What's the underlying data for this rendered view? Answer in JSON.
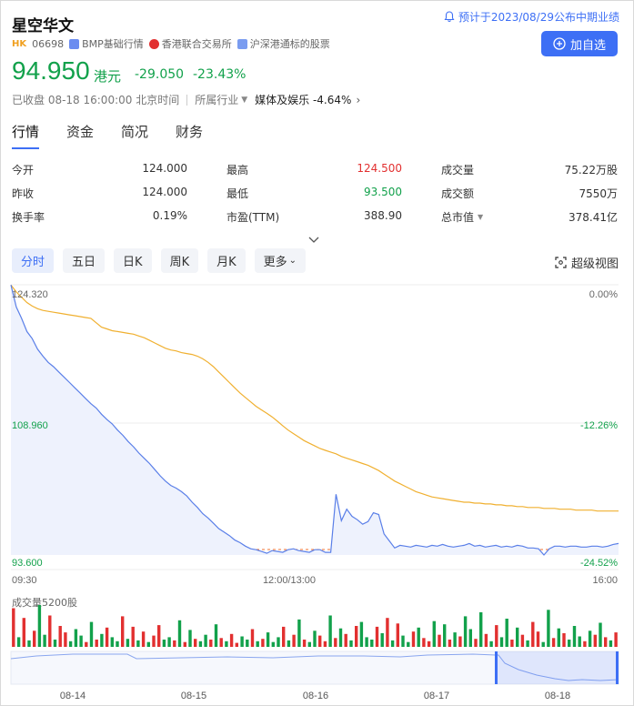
{
  "stock": {
    "name": "星空华文",
    "market": "HK",
    "code": "06698",
    "tag1": "BMP基础行情",
    "tag2": "香港联合交易所",
    "tag3": "沪深港通标的股票",
    "notice": "预计于2023/08/29公布中期业绩",
    "add_button": "加自选",
    "price": "94.950",
    "currency": "港元",
    "change": "-29.050",
    "change_pct": "-23.43%",
    "status_time": "已收盘 08-18 16:00:00 北京时间",
    "industry_label": "所属行业",
    "industry_value": "媒体及娱乐 -4.64%"
  },
  "tabs": [
    "行情",
    "资金",
    "简况",
    "财务"
  ],
  "stats": {
    "open_label": "今开",
    "open": "124.000",
    "high_label": "最高",
    "high": "124.500",
    "volume_label": "成交量",
    "volume": "75.22万股",
    "prev_label": "昨收",
    "prev": "124.000",
    "low_label": "最低",
    "low": "93.500",
    "amount_label": "成交额",
    "amount": "7550万",
    "turnover_label": "换手率",
    "turnover": "0.19%",
    "pe_label": "市盈(TTM)",
    "pe": "388.90",
    "mcap_label": "总市值",
    "mcap": "378.41亿"
  },
  "periods": [
    "分时",
    "五日",
    "日K",
    "周K",
    "月K",
    "更多"
  ],
  "super_view": "超级视图",
  "colors": {
    "accent": "#3d6ff5",
    "down": "#12a14b",
    "up": "#e23030",
    "avg_line": "#f0b030",
    "price_line": "#5a7fe8"
  },
  "chart_data": {
    "type": "line",
    "y_top_label": "124.320",
    "y_mid_label": "108.960",
    "y_bottom_label": "93.600",
    "pct_top": "0.00%",
    "pct_mid": "-12.26%",
    "pct_bottom": "-24.52%",
    "x_labels": [
      "09:30",
      "12:00/13:00",
      "16:00"
    ],
    "ylim": [
      93.6,
      124.32
    ],
    "prev_close": 124.0,
    "series": [
      {
        "values": [
          124.3,
          121.8,
          120.5,
          119.0,
          118.2,
          117.0,
          116.2,
          115.5,
          115.0,
          114.4,
          113.8,
          113.2,
          112.6,
          112.0,
          111.4,
          110.8,
          110.3,
          109.6,
          109.0,
          108.5,
          107.8,
          107.2,
          106.5,
          105.9,
          105.2,
          104.6,
          104.0,
          103.3,
          102.6,
          102.0,
          101.5,
          101.2,
          100.8,
          100.3,
          99.6,
          99.0,
          98.3,
          97.8,
          97.2,
          96.6,
          96.2,
          95.8,
          95.3,
          95.0,
          94.6,
          94.3,
          94.2,
          94.0,
          93.8,
          94.1,
          94.0,
          93.9,
          94.2,
          94.3,
          94.1,
          94.0,
          93.9,
          94.2,
          94.2,
          93.9,
          93.9,
          100.5,
          97.5,
          98.8,
          98.0,
          97.6,
          97.1,
          97.4,
          98.4,
          98.2,
          96.0,
          95.2,
          94.4,
          94.7,
          94.6,
          94.5,
          94.7,
          94.6,
          94.5,
          94.7,
          94.6,
          94.8,
          94.6,
          94.5,
          94.6,
          94.7,
          94.9,
          94.6,
          94.7,
          94.5,
          94.6,
          94.7,
          94.5,
          94.6,
          94.5,
          94.7,
          94.6,
          94.4,
          94.4,
          94.3,
          93.6,
          94.3,
          94.6,
          94.6,
          94.5,
          94.6,
          94.6,
          94.5,
          94.5,
          94.6,
          94.6,
          94.5,
          94.6,
          94.8,
          94.9
        ]
      },
      {
        "values": [
          124.3,
          123.5,
          122.9,
          122.3,
          121.9,
          121.6,
          121.4,
          121.3,
          121.2,
          121.1,
          121.0,
          120.9,
          120.8,
          120.7,
          120.6,
          120.5,
          120.0,
          119.5,
          119.3,
          119.1,
          119.0,
          118.9,
          118.8,
          118.7,
          118.5,
          118.3,
          118.0,
          117.7,
          117.4,
          117.1,
          116.9,
          116.8,
          116.6,
          116.5,
          116.4,
          116.2,
          115.9,
          115.5,
          115.0,
          114.4,
          113.8,
          113.2,
          112.6,
          112.0,
          111.5,
          111.0,
          110.5,
          110.1,
          109.7,
          109.3,
          108.8,
          108.3,
          107.8,
          107.4,
          107.0,
          106.6,
          106.3,
          106.0,
          105.7,
          105.5,
          105.3,
          105.1,
          104.8,
          104.6,
          104.4,
          104.2,
          104.0,
          103.8,
          103.5,
          103.2,
          102.8,
          102.4,
          102.0,
          101.7,
          101.4,
          101.1,
          100.8,
          100.6,
          100.4,
          100.2,
          100.1,
          100.0,
          99.9,
          99.8,
          99.7,
          99.6,
          99.6,
          99.5,
          99.5,
          99.4,
          99.4,
          99.3,
          99.3,
          99.2,
          99.2,
          99.1,
          99.1,
          99.0,
          99.0,
          99.0,
          98.9,
          98.9,
          98.9,
          98.8,
          98.8,
          98.8,
          98.7,
          98.7,
          98.7,
          98.7,
          98.6,
          98.6,
          98.6,
          98.6,
          98.6
        ]
      }
    ],
    "volume_label": "成交量5200股",
    "volume_max": 5200,
    "volume_bars": [
      4800,
      1200,
      3600,
      800,
      2000,
      5200,
      1500,
      3900,
      900,
      2600,
      1800,
      700,
      2200,
      1400,
      600,
      3100,
      900,
      1600,
      2400,
      1200,
      700,
      3800,
      1000,
      2500,
      800,
      1900,
      600,
      1400,
      2700,
      900,
      1200,
      800,
      3300,
      600,
      2100,
      1000,
      700,
      1500,
      900,
      2800,
      1100,
      700,
      1600,
      500,
      1300,
      900,
      2200,
      700,
      1000,
      1800,
      600,
      1200,
      2500,
      800,
      1500,
      3400,
      900,
      600,
      2000,
      1400,
      700,
      3900,
      1100,
      2300,
      1600,
      800,
      2600,
      3100,
      1200,
      900,
      2500,
      1700,
      3600,
      800,
      2900,
      1400,
      600,
      1900,
      2400,
      1100,
      700,
      3200,
      1500,
      2800,
      900,
      1800,
      1300,
      3800,
      2200,
      1000,
      4300,
      1600,
      700,
      2700,
      1200,
      3500,
      900,
      2400,
      1500,
      800,
      3100,
      1900,
      600,
      4600,
      1100,
      2300,
      1700,
      900,
      2600,
      1300,
      700,
      2000,
      1500,
      3000,
      1200,
      800,
      1800
    ],
    "volume_colors": "rgrgrggrgrrgggrgrgrggrgrgrgrrggrgrgrggrgrgrrggrgrgggrgrgrggrrgrgrgrgggrgrgrggrgrrgrgrgrggrgrgrggrgrgrrggrgrgggrgrgrgr",
    "overview_dates": [
      "08-14",
      "08-15",
      "08-16",
      "08-17",
      "08-18"
    ]
  }
}
